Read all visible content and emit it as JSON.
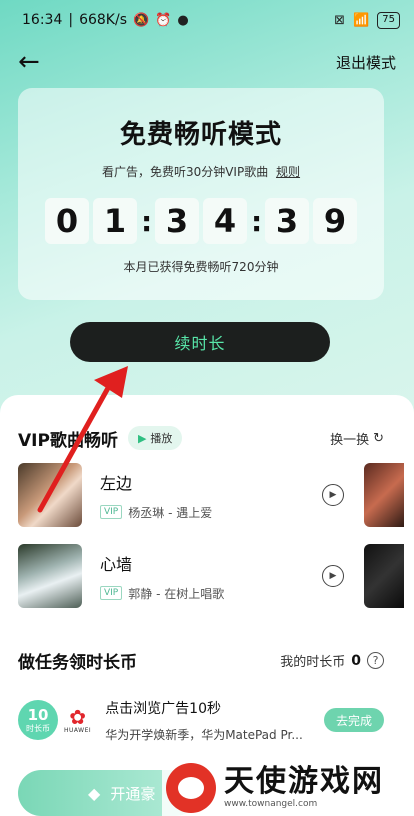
{
  "status_bar": {
    "time": "16:34",
    "speed": "668K/s",
    "battery": "75"
  },
  "nav": {
    "exit_label": "退出模式"
  },
  "card": {
    "title": "免费畅听模式",
    "subtitle": "看广告，免费听30分钟VIP歌曲",
    "rule_link": "规则",
    "timer_digits": [
      "0",
      "1",
      "3",
      "4",
      "3",
      "9"
    ],
    "note": "本月已获得免费畅听720分钟"
  },
  "extend_button": "续时长",
  "vip_songs": {
    "title": "VIP歌曲畅听",
    "play_label": "播放",
    "refresh_label": "换一换",
    "items": [
      {
        "name": "左边",
        "vip": "VIP",
        "meta": "杨丞琳 - 遇上爱"
      },
      {
        "name": "心墙",
        "vip": "VIP",
        "meta": "郭静 - 在树上唱歌"
      }
    ]
  },
  "tasks": {
    "title": "做任务领时长币",
    "coins_label": "我的时长币",
    "coins_value": "0",
    "items": [
      {
        "badge_number": "10",
        "badge_unit": "时长币",
        "brand": "HUAWEI",
        "title": "点击浏览广告10秒",
        "desc": "华为开学焕新季，华为MatePad Pr...",
        "button": "去完成"
      }
    ]
  },
  "vip_bar": {
    "label": "开通豪"
  },
  "watermark": {
    "title": "天使游戏网",
    "url": "www.townangel.com"
  },
  "colors": {
    "accent": "#58e6a9",
    "button_bg": "#1c1f1e",
    "arrow": "#e0201f"
  }
}
